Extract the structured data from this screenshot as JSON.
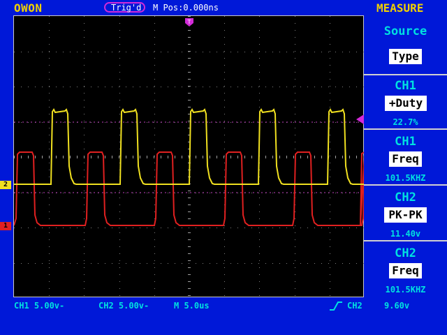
{
  "header": {
    "brand": "OWON",
    "trig_status": "Trig'd",
    "m_pos": "M Pos:0.000ns",
    "panel_title": "MEASURE"
  },
  "channels": {
    "ch1": {
      "marker": "1",
      "color": "#e02020"
    },
    "ch2": {
      "marker": "2",
      "color": "#f0e020"
    }
  },
  "measure": {
    "source_label": "Source",
    "type_label": "Type",
    "items": [
      {
        "source": "CH1",
        "type": "+Duty",
        "value": "22.7%"
      },
      {
        "source": "CH1",
        "type": "Freq",
        "value": "101.5KHZ"
      },
      {
        "source": "CH2",
        "type": "PK-PK",
        "value": "11.40v"
      },
      {
        "source": "CH2",
        "type": "Freq",
        "value": "101.5KHZ"
      }
    ]
  },
  "footer": {
    "ch1_scale": "CH1  5.00v-",
    "ch2_scale": "CH2  5.00v-",
    "timebase": "M 5.0us",
    "trigger_source": "CH2",
    "trigger_level": "9.60v"
  },
  "colors": {
    "background": "#0018d8",
    "accent_yellow": "#f0d000",
    "accent_cyan": "#00e0e0",
    "trigger_magenta": "#d22ad8",
    "ch1_red": "#e02020",
    "ch2_yellow": "#f0e020"
  }
}
